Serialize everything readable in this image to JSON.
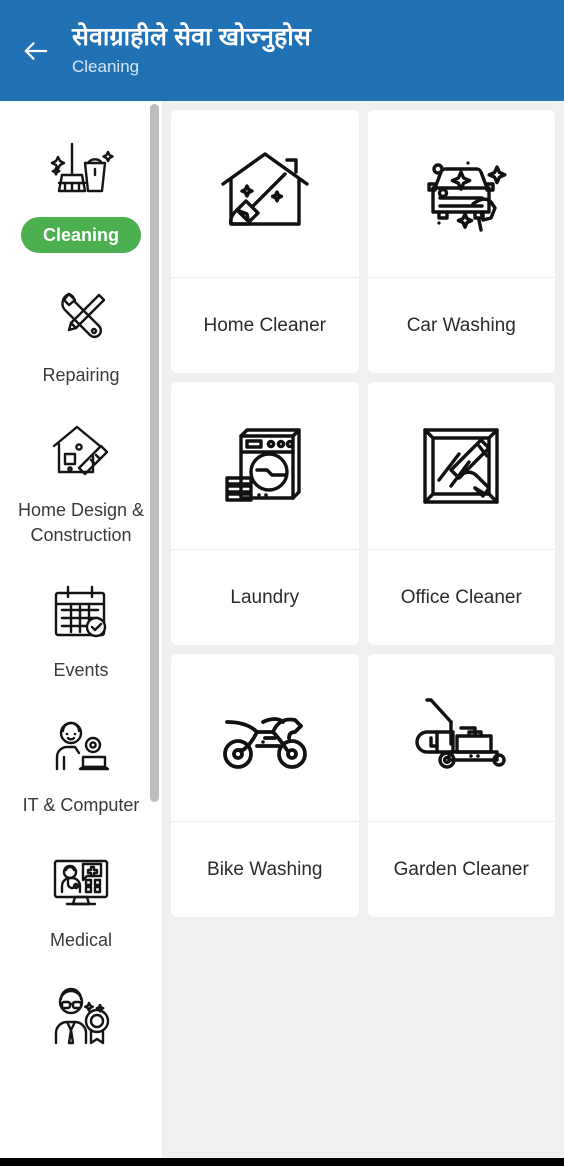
{
  "header": {
    "back_icon": "arrow-left-icon",
    "title": "सेवाग्राहीले सेवा खोज्नुहोस",
    "subtitle": "Cleaning",
    "background_color": "#2171b5",
    "title_color": "#ffffff",
    "subtitle_color": "#d8e6f2"
  },
  "sidebar": {
    "selected_index": 0,
    "selected_pill_color": "#4caf50",
    "items": [
      {
        "label": "Cleaning",
        "icon": "broom-bucket-icon",
        "selected": true
      },
      {
        "label": "Repairing",
        "icon": "wrench-screwdriver-icon",
        "selected": false
      },
      {
        "label": "Home Design & Construction",
        "icon": "house-blueprint-ruler-icon",
        "selected": false
      },
      {
        "label": "Events",
        "icon": "calendar-check-icon",
        "selected": false
      },
      {
        "label": "IT & Computer",
        "icon": "technician-computer-icon",
        "selected": false
      },
      {
        "label": "Medical",
        "icon": "doctor-monitor-icon",
        "selected": false
      },
      {
        "label": "",
        "icon": "professional-award-icon",
        "selected": false
      }
    ],
    "scrollbar": {
      "color": "#bdbdbd",
      "visible": true
    }
  },
  "main": {
    "background_color": "#eef0f2",
    "cards": [
      {
        "label": "Home Cleaner",
        "icon": "house-broom-icon"
      },
      {
        "label": "Car Washing",
        "icon": "car-wash-hand-icon"
      },
      {
        "label": "Laundry",
        "icon": "washing-machine-icon"
      },
      {
        "label": "Office Cleaner",
        "icon": "window-squeegee-icon"
      },
      {
        "label": "Bike Washing",
        "icon": "motorbike-icon"
      },
      {
        "label": "Garden Cleaner",
        "icon": "lawn-mower-icon"
      }
    ]
  }
}
